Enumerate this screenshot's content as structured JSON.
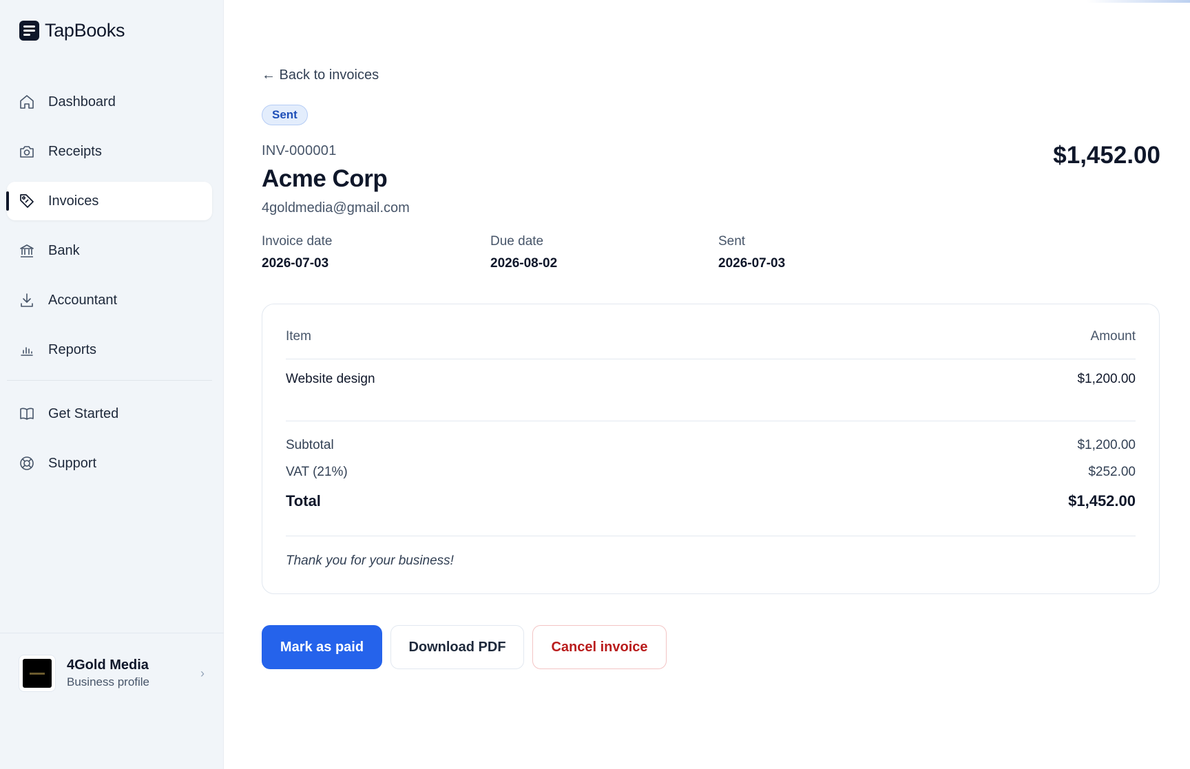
{
  "app": {
    "name": "TapBooks"
  },
  "sidebar": {
    "items": [
      {
        "label": "Dashboard",
        "icon": "home-icon"
      },
      {
        "label": "Receipts",
        "icon": "camera-icon"
      },
      {
        "label": "Invoices",
        "icon": "tag-icon",
        "active": true
      },
      {
        "label": "Bank",
        "icon": "bank-icon"
      },
      {
        "label": "Accountant",
        "icon": "download-icon"
      },
      {
        "label": "Reports",
        "icon": "bar-chart-icon"
      }
    ],
    "secondary_items": [
      {
        "label": "Get Started",
        "icon": "book-icon"
      },
      {
        "label": "Support",
        "icon": "lifebuoy-icon"
      }
    ],
    "profile": {
      "name": "4Gold Media",
      "subtitle": "Business profile"
    }
  },
  "invoice": {
    "back_label": "← Back to invoices",
    "status": "Sent",
    "number": "INV-000001",
    "client_name": "Acme Corp",
    "client_email": "4goldmedia@gmail.com",
    "total_display": "$1,452.00",
    "meta": [
      {
        "label": "Invoice date",
        "value": "2026-07-03"
      },
      {
        "label": "Due date",
        "value": "2026-08-02"
      },
      {
        "label": "Sent",
        "value": "2026-07-03"
      }
    ],
    "table": {
      "headers": {
        "item": "Item",
        "amount": "Amount"
      },
      "rows": [
        {
          "item": "Website design",
          "amount": "$1,200.00"
        }
      ]
    },
    "summary": {
      "subtotal_label": "Subtotal",
      "subtotal_value": "$1,200.00",
      "vat_label": "VAT (21%)",
      "vat_value": "$252.00",
      "total_label": "Total",
      "total_value": "$1,452.00"
    },
    "note": "Thank you for your business!"
  },
  "actions": {
    "mark_paid": "Mark as paid",
    "download_pdf": "Download PDF",
    "cancel": "Cancel invoice"
  },
  "colors": {
    "primary": "#2563eb",
    "danger": "#b91c1c",
    "badge_bg": "#e3edfc",
    "sidebar_bg": "#f1f5f9"
  }
}
